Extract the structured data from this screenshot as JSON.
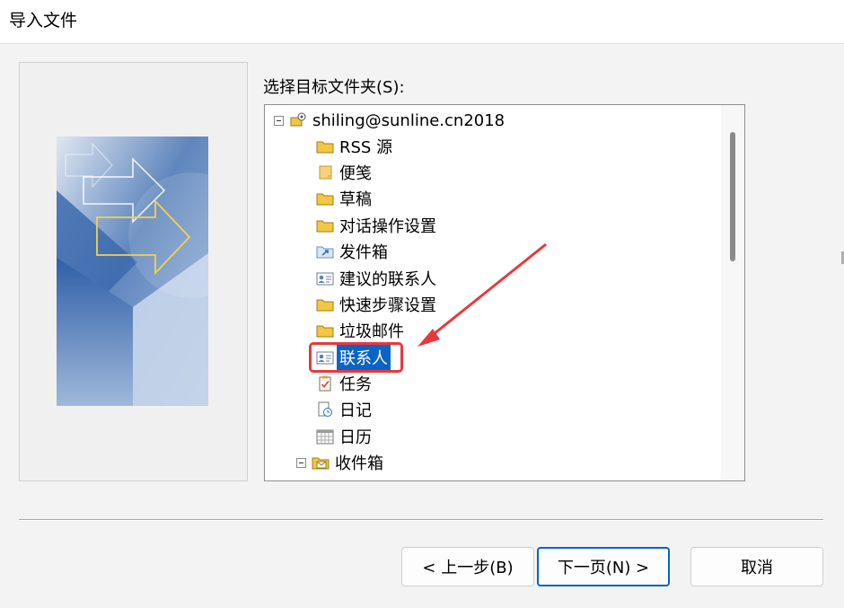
{
  "window": {
    "title": "导入文件"
  },
  "folder_picker": {
    "label": "选择目标文件夹(S):",
    "account": "shiling@sunline.cn2018",
    "items": [
      {
        "label": "RSS 源",
        "icon": "folder-icon"
      },
      {
        "label": "便笺",
        "icon": "note-icon"
      },
      {
        "label": "草稿",
        "icon": "folder-icon"
      },
      {
        "label": "对话操作设置",
        "icon": "folder-icon"
      },
      {
        "label": "发件箱",
        "icon": "outbox-icon"
      },
      {
        "label": "建议的联系人",
        "icon": "contact-card-icon"
      },
      {
        "label": "快速步骤设置",
        "icon": "folder-icon"
      },
      {
        "label": "垃圾邮件",
        "icon": "folder-icon"
      },
      {
        "label": "联系人",
        "icon": "contact-card-icon",
        "selected": true
      },
      {
        "label": "任务",
        "icon": "task-icon"
      },
      {
        "label": "日记",
        "icon": "journal-icon"
      },
      {
        "label": "日历",
        "icon": "calendar-icon"
      },
      {
        "label": "收件箱",
        "icon": "inbox-icon"
      }
    ]
  },
  "buttons": {
    "back": "< 上一步(B)",
    "next": "下一页(N) >",
    "cancel": "取消"
  },
  "colors": {
    "selection": "#0a64c8",
    "callout": "#e8383d",
    "default_button_border": "#0067c0",
    "folder_yellow": "#f2c744"
  }
}
